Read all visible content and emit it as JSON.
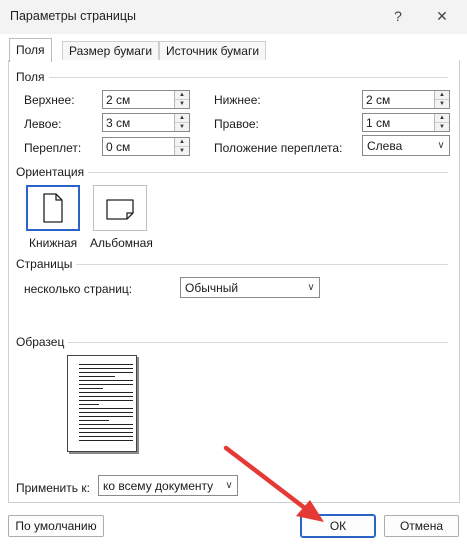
{
  "window": {
    "title": "Параметры страницы",
    "help_glyph": "?",
    "close_glyph": "✕"
  },
  "tabs": [
    {
      "label": "Поля",
      "active": true
    },
    {
      "label": "Размер бумаги",
      "active": false
    },
    {
      "label": "Источник бумаги",
      "active": false
    }
  ],
  "margins": {
    "group_label": "Поля",
    "top": {
      "label": "Верхнее:",
      "value": "2 см"
    },
    "bottom": {
      "label": "Нижнее:",
      "value": "2 см"
    },
    "left": {
      "label": "Левое:",
      "value": "3 см"
    },
    "right": {
      "label": "Правое:",
      "value": "1 см"
    },
    "gutter": {
      "label": "Переплет:",
      "value": "0 см"
    },
    "gutter_position": {
      "label": "Положение переплета:",
      "value": "Слева"
    }
  },
  "orientation": {
    "group_label": "Ориентация",
    "portrait": "Книжная",
    "landscape": "Альбомная",
    "selected": "portrait"
  },
  "pages": {
    "group_label": "Страницы",
    "multiple_label": "несколько страниц:",
    "multiple_value": "Обычный"
  },
  "preview": {
    "group_label": "Образец"
  },
  "apply": {
    "label": "Применить к:",
    "value": "ко всему документу"
  },
  "buttons": {
    "default": "По умолчанию",
    "ok": "ОК",
    "cancel": "Отмена"
  },
  "colors": {
    "accent": "#2a64c4",
    "arrow": "#e53935"
  }
}
